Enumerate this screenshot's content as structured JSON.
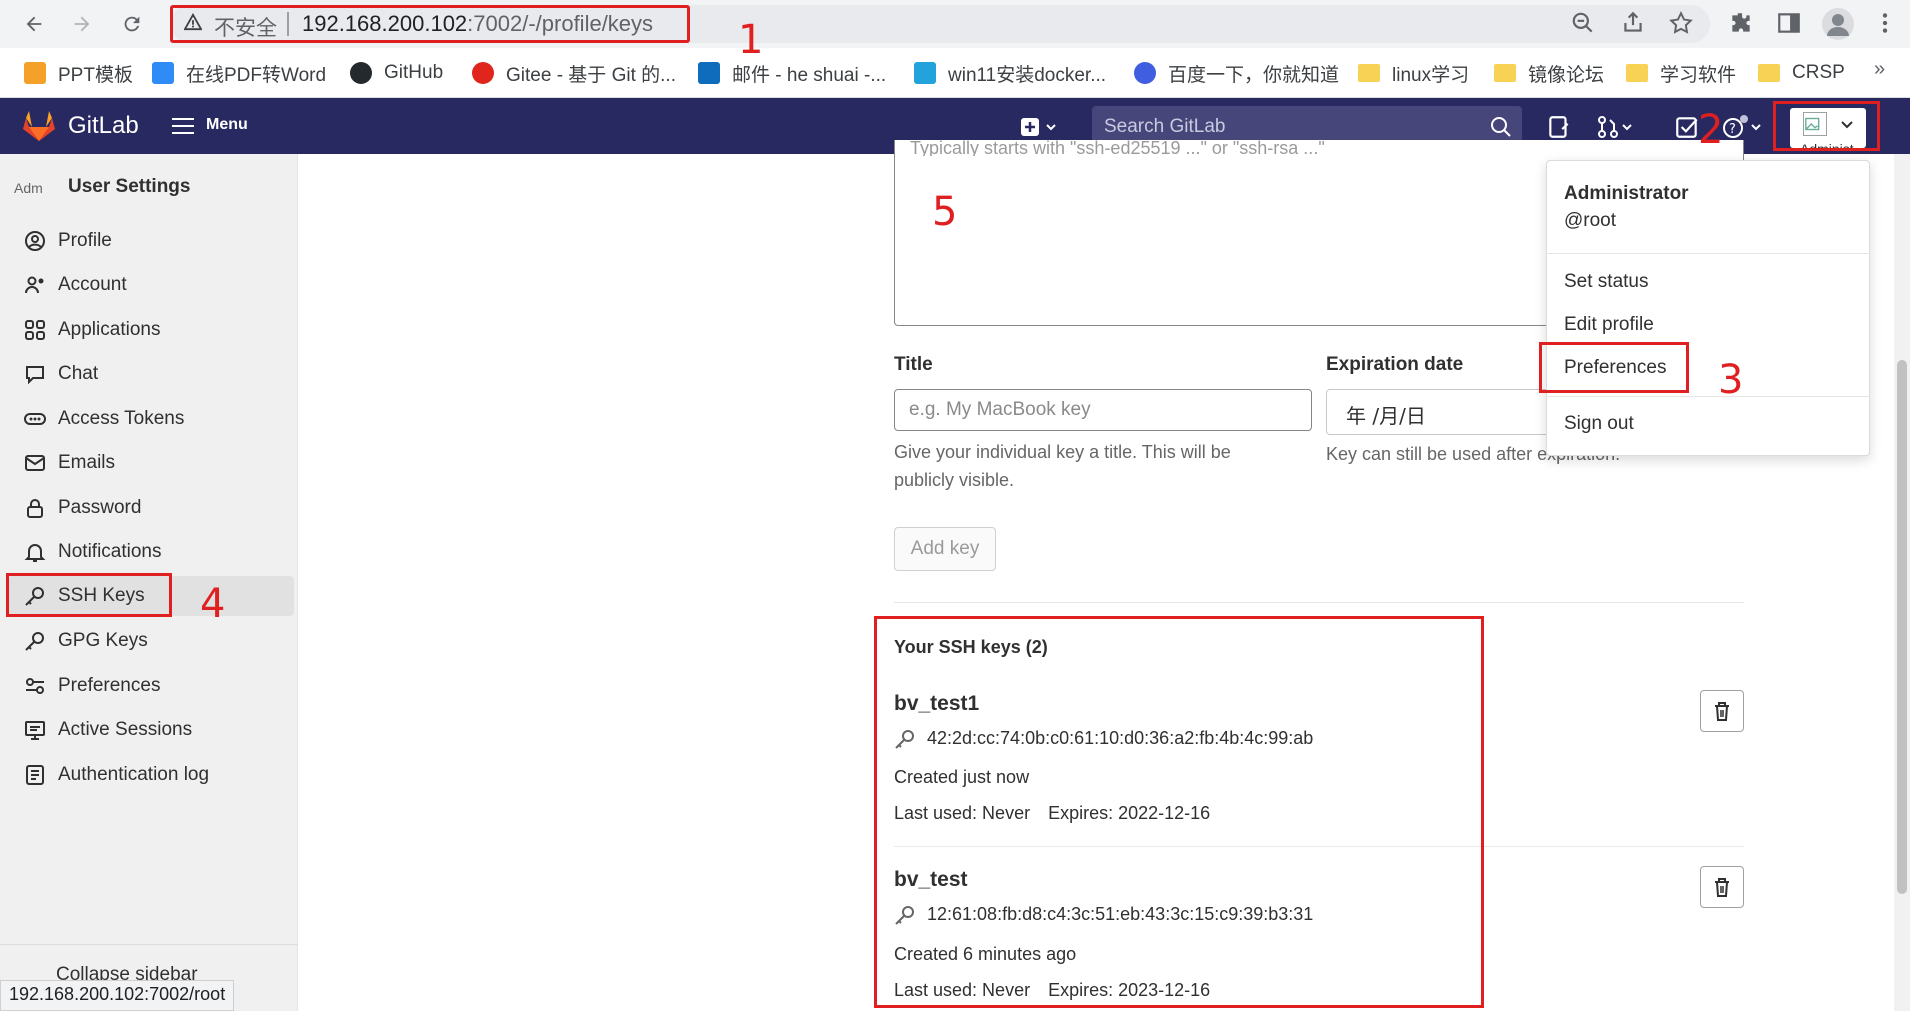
{
  "browser": {
    "address_insecure": "不安全",
    "address_host": "192.168.200.102",
    "address_path": ":7002/-/profile/keys",
    "status_url": "192.168.200.102:7002/root"
  },
  "bookmarks": [
    {
      "label": "PPT模板",
      "icon": "ppt-icon",
      "color": "#f4a12a"
    },
    {
      "label": "在线PDF转Word",
      "icon": "pdf-icon",
      "color": "#2f8bf5"
    },
    {
      "label": "GitHub",
      "icon": "github-icon",
      "color": "#24292e"
    },
    {
      "label": "Gitee - 基于 Git 的...",
      "icon": "gitee-icon",
      "color": "#e0251c"
    },
    {
      "label": "邮件 - he shuai -...",
      "icon": "outlook-icon",
      "color": "#0f6cbd"
    },
    {
      "label": "win11安装docker...",
      "icon": "bilibili-icon",
      "color": "#23a3db"
    },
    {
      "label": "百度一下，你就知道",
      "icon": "baidu-icon",
      "color": "#3f5fe0"
    },
    {
      "label": "linux学习",
      "icon": "folder-icon",
      "color": "#f7d254"
    },
    {
      "label": "镜像论坛",
      "icon": "folder-icon",
      "color": "#f7d254"
    },
    {
      "label": "学习软件",
      "icon": "folder-icon",
      "color": "#f7d254"
    },
    {
      "label": "CRSP",
      "icon": "folder-icon",
      "color": "#f7d254"
    }
  ],
  "gitlab": {
    "brand": "GitLab",
    "menu_label": "Menu",
    "search_placeholder": "Search GitLab",
    "user_button_name": "Administ",
    "header_bg": "#292961"
  },
  "sidebar": {
    "avatar_alt": "Adm",
    "title": "User Settings",
    "items": [
      {
        "label": "Profile",
        "icon": "profile-icon"
      },
      {
        "label": "Account",
        "icon": "account-icon"
      },
      {
        "label": "Applications",
        "icon": "applications-icon"
      },
      {
        "label": "Chat",
        "icon": "chat-icon"
      },
      {
        "label": "Access Tokens",
        "icon": "token-icon"
      },
      {
        "label": "Emails",
        "icon": "email-icon"
      },
      {
        "label": "Password",
        "icon": "lock-icon"
      },
      {
        "label": "Notifications",
        "icon": "bell-icon"
      },
      {
        "label": "SSH Keys",
        "icon": "key-icon",
        "active": true
      },
      {
        "label": "GPG Keys",
        "icon": "key-icon"
      },
      {
        "label": "Preferences",
        "icon": "preferences-icon"
      },
      {
        "label": "Active Sessions",
        "icon": "monitor-icon"
      },
      {
        "label": "Authentication log",
        "icon": "log-icon"
      }
    ],
    "collapse_label": "Collapse sidebar"
  },
  "form": {
    "key_placeholder": "Typically starts with \"ssh-ed25519 ...\" or \"ssh-rsa ...\"",
    "title_label": "Title",
    "title_placeholder": "e.g. My MacBook key",
    "title_help": "Give your individual key a title. This will be publicly visible.",
    "expiration_label": "Expiration date",
    "expiration_value": "年 /月/日",
    "expiration_help": "Key can still be used after expiration.",
    "add_key_label": "Add key"
  },
  "keys": {
    "heading": "Your SSH keys (2)",
    "items": [
      {
        "title": "bv_test1",
        "fingerprint": "42:2d:cc:74:0b:c0:61:10:d0:36:a2:fb:4b:4c:99:ab",
        "created": "Created just now",
        "last_used": "Last used: Never",
        "expires": "Expires: 2022-12-16"
      },
      {
        "title": "bv_test",
        "fingerprint": "12:61:08:fb:d8:c4:3c:51:eb:43:3c:15:c9:39:b3:31",
        "created": "Created 6 minutes ago",
        "last_used": "Last used: Never",
        "expires": "Expires: 2023-12-16"
      }
    ]
  },
  "dropdown": {
    "name": "Administrator",
    "handle": "@root",
    "set_status": "Set status",
    "edit_profile": "Edit profile",
    "preferences": "Preferences",
    "sign_out": "Sign out"
  },
  "annotations": {
    "n1": "1",
    "n2": "2",
    "n3": "3",
    "n4": "4",
    "n5": "5",
    "color": "#e02020"
  }
}
